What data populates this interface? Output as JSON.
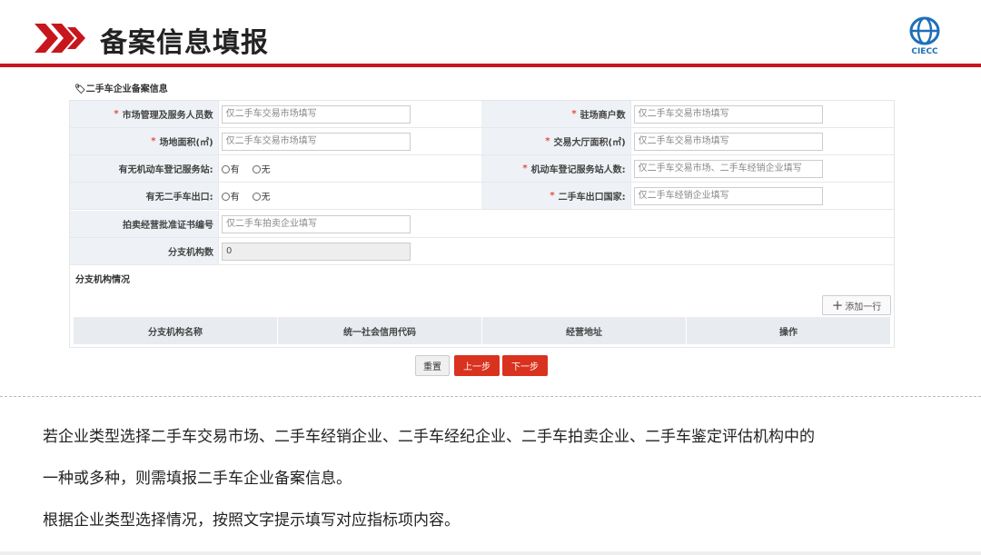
{
  "header": {
    "title": "备案信息填报",
    "logo_text": "CIECC",
    "accent": "#c8161d"
  },
  "section_title": "二手车企业备案信息",
  "form": {
    "rows": [
      {
        "l_label": "市场管理及服务人员数",
        "l_req": true,
        "l_placeholder": "仅二手车交易市场填写",
        "r_label": "驻场商户数",
        "r_req": true,
        "r_placeholder": "仅二手车交易市场填写"
      },
      {
        "l_label": "场地面积(㎡)",
        "l_req": true,
        "l_placeholder": "仅二手车交易市场填写",
        "r_label": "交易大厅面积(㎡)",
        "r_req": true,
        "r_placeholder": "仅二手车交易市场填写"
      },
      {
        "l_label": "有无机动车登记服务站:",
        "r_label": "机动车登记服务站人数:",
        "r_req": true,
        "r_placeholder": "仅二手车交易市场、二手车经销企业填写"
      },
      {
        "l_label": "有无二手车出口:",
        "r_label": "二手车出口国家:",
        "r_req": true,
        "r_placeholder": "仅二手车经销企业填写"
      },
      {
        "l_label": "拍卖经营批准证书编号",
        "l_placeholder": "仅二手车拍卖企业填写"
      },
      {
        "l_label": "分支机构数",
        "l_value": "0"
      }
    ],
    "radio_yes": "有",
    "radio_no": "无",
    "required_mark": "*"
  },
  "branch": {
    "title": "分支机构情况",
    "add_label": "添加一行",
    "columns": [
      "分支机构名称",
      "统一社会信用代码",
      "经营地址",
      "操作"
    ]
  },
  "buttons": {
    "reset": "重置",
    "prev": "上一步",
    "next": "下一步"
  },
  "notes": [
    "若企业类型选择二手车交易市场、二手车经销企业、二手车经纪企业、二手车拍卖企业、二手车鉴定评估机构中的",
    "一种或多种，则需填报二手车企业备案信息。",
    "根据企业类型选择情况，按照文字提示填写对应指标项内容。"
  ]
}
